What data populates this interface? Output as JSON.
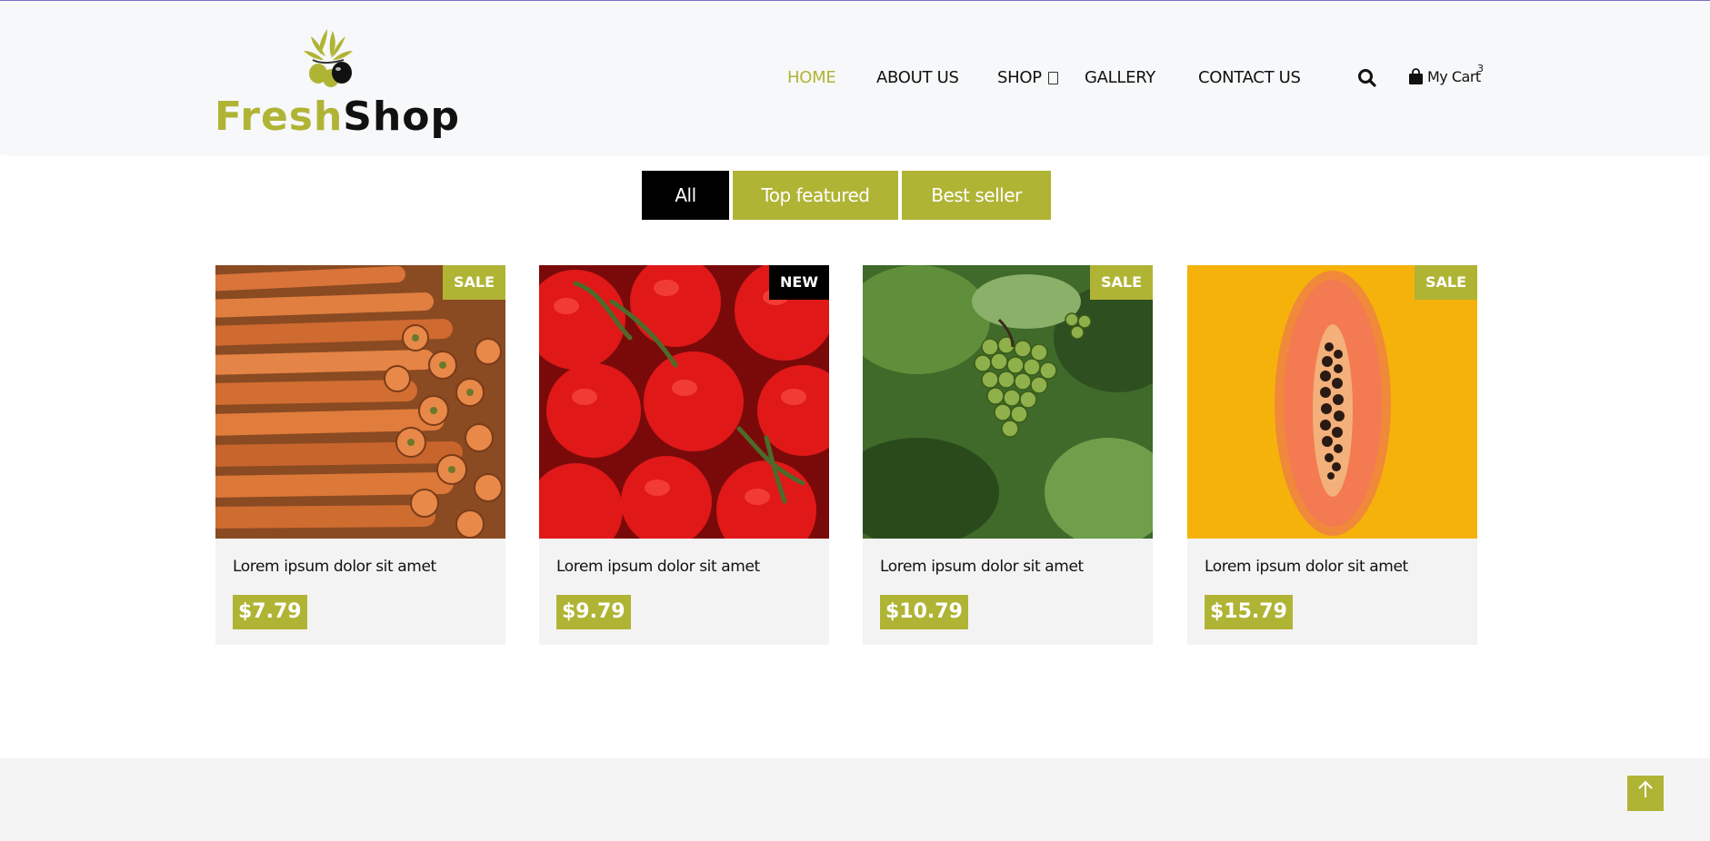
{
  "brand": {
    "logo_part1": "Fresh",
    "logo_part2": "Shop"
  },
  "nav": {
    "home": "HOME",
    "about": "ABOUT US",
    "shop": "SHOP",
    "gallery": "GALLERY",
    "contact": "CONTACT US"
  },
  "header_icons": {
    "search": "search-icon",
    "cart_icon": "shopping-bag-icon",
    "cart_label": "My Cart",
    "cart_count": "3"
  },
  "filters": [
    "All",
    "Top featured",
    "Best seller"
  ],
  "products": [
    {
      "title": "Lorem ipsum dolor sit amet",
      "price": "$7.79",
      "badge": "SALE",
      "image": "carrots"
    },
    {
      "title": "Lorem ipsum dolor sit amet",
      "price": "$9.79",
      "badge": "NEW",
      "image": "tomatoes"
    },
    {
      "title": "Lorem ipsum dolor sit amet",
      "price": "$10.79",
      "badge": "SALE",
      "image": "grapes"
    },
    {
      "title": "Lorem ipsum dolor sit amet",
      "price": "$15.79",
      "badge": "SALE",
      "image": "papaya"
    }
  ],
  "colors": {
    "accent": "#b0b435",
    "dark": "#000000",
    "header_bg": "#f7f8f9",
    "card_bg": "#f3f3f3"
  },
  "back_to_top_icon": "arrow-up-icon"
}
